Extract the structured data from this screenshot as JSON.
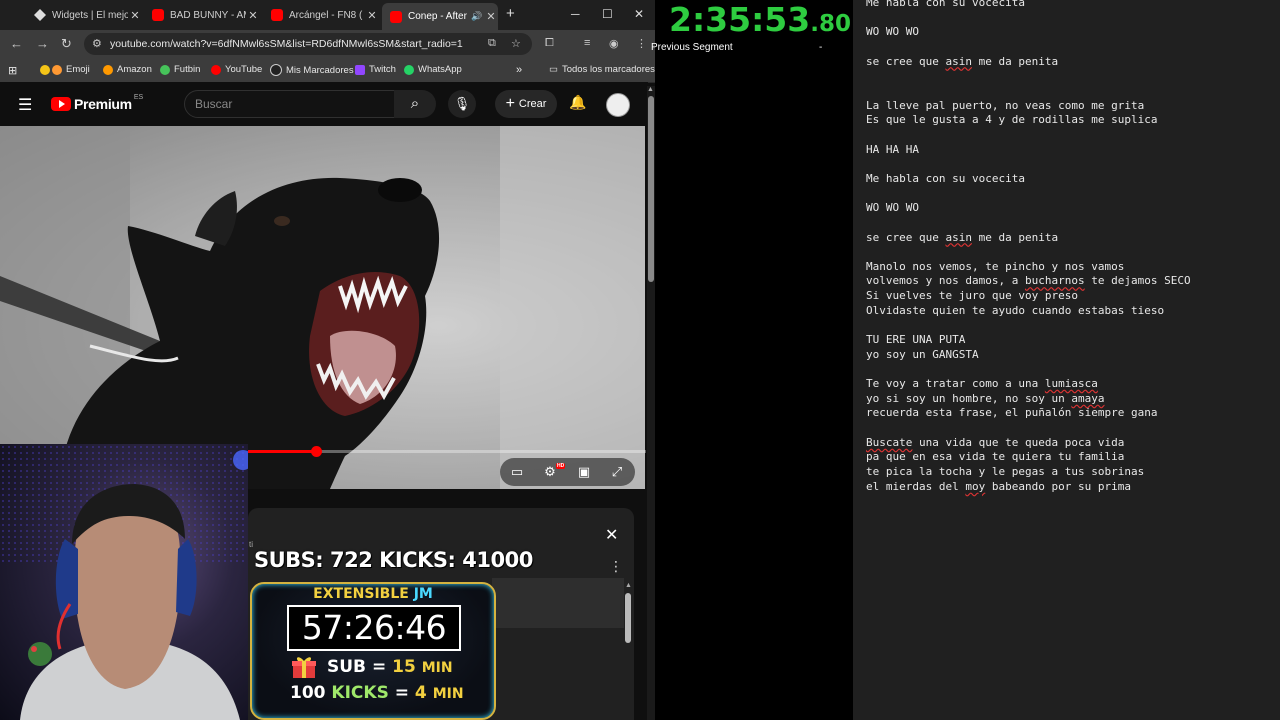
{
  "browser": {
    "tabs": [
      {
        "title": "Widgets | El mejor",
        "icon": "widget",
        "active": false
      },
      {
        "title": "BAD BUNNY - AM",
        "icon": "youtube",
        "active": false
      },
      {
        "title": "Arcángel - FN8 (",
        "icon": "youtube",
        "active": false
      },
      {
        "title": "Conep - After",
        "icon": "youtube",
        "active": true
      }
    ],
    "url": "youtube.com/watch?v=6dfNMwl6sSM&list=RD6dfNMwl6sSM&start_radio=1",
    "bookmarks": [
      {
        "label": "Emoji",
        "color": "#f5c518"
      },
      {
        "label": "Amazon",
        "color": "#ff9900"
      },
      {
        "label": "Futbin",
        "color": "#46c35a"
      },
      {
        "label": "YouTube",
        "color": "#ff0000"
      },
      {
        "label": "Mis Marcadores",
        "color": "#3a3a3a"
      },
      {
        "label": "Twitch",
        "color": "#9146ff"
      },
      {
        "label": "WhatsApp",
        "color": "#25d366"
      }
    ],
    "all_bookmarks": "Todos los marcadores"
  },
  "youtube": {
    "logo_text": "Premium",
    "region": "ES",
    "search_placeholder": "Buscar",
    "create_label": "Crear",
    "progress_fraction": 0.17,
    "accent": "#ff0000"
  },
  "panel": {
    "label": "ti",
    "close_glyph": "✕"
  },
  "overlay": {
    "subs_kicks": "SUBS: 722  KICKS: 41000",
    "ext_title_1": "EXTENSIBLE",
    "ext_title_2": "JM",
    "ext_timer": "57:26:46",
    "sub_label": "SUB",
    "eq": "=",
    "sub_value": "15",
    "min_label": "MIN",
    "kicks_count": "100",
    "kicks_label": "KICKS",
    "kicks_value": "4"
  },
  "livesplit": {
    "time_main": "2:35:53",
    "time_fraction": ".80",
    "prev_segment_label": "Previous Segment",
    "prev_segment_value": "-",
    "color": "#2ecc40"
  },
  "lyrics": [
    "Me habla con su vocecita",
    "",
    "WO WO WO",
    "",
    "se cree que asin me da penita",
    "",
    "",
    "La lleve pal puerto, no veas como me grita",
    "Es que le gusta a 4 y de rodillas me suplica",
    "",
    "HA HA HA",
    "",
    "Me habla con su vocecita",
    "",
    "WO WO WO",
    "",
    "se cree que asin me da penita",
    "",
    "Manolo nos vemos, te pincho y nos vamos",
    "volvemos y nos damos, a bucharnos te dejamos SECO",
    "Si vuelves te juro que voy preso",
    "Olvidaste quien te ayudo cuando estabas tieso",
    "",
    "TU ERE UNA PUTA",
    "yo soy un GANGSTA",
    "",
    "Te voy a tratar como a una lumiasca",
    "yo si soy un hombre, no soy un amaya",
    "recuerda esta frase, el puñalón siempre gana",
    "",
    "Buscate una vida que te queda poca vida",
    "pa que en esa vida te quiera tu familia",
    "te pica la tocha y le pegas a tus sobrinas",
    "el mierdas del moy babeando por su prima"
  ],
  "spellcheck_words": [
    "asin",
    "bucharnos",
    "lumiasca",
    "amaya",
    "Buscate",
    "moy"
  ]
}
